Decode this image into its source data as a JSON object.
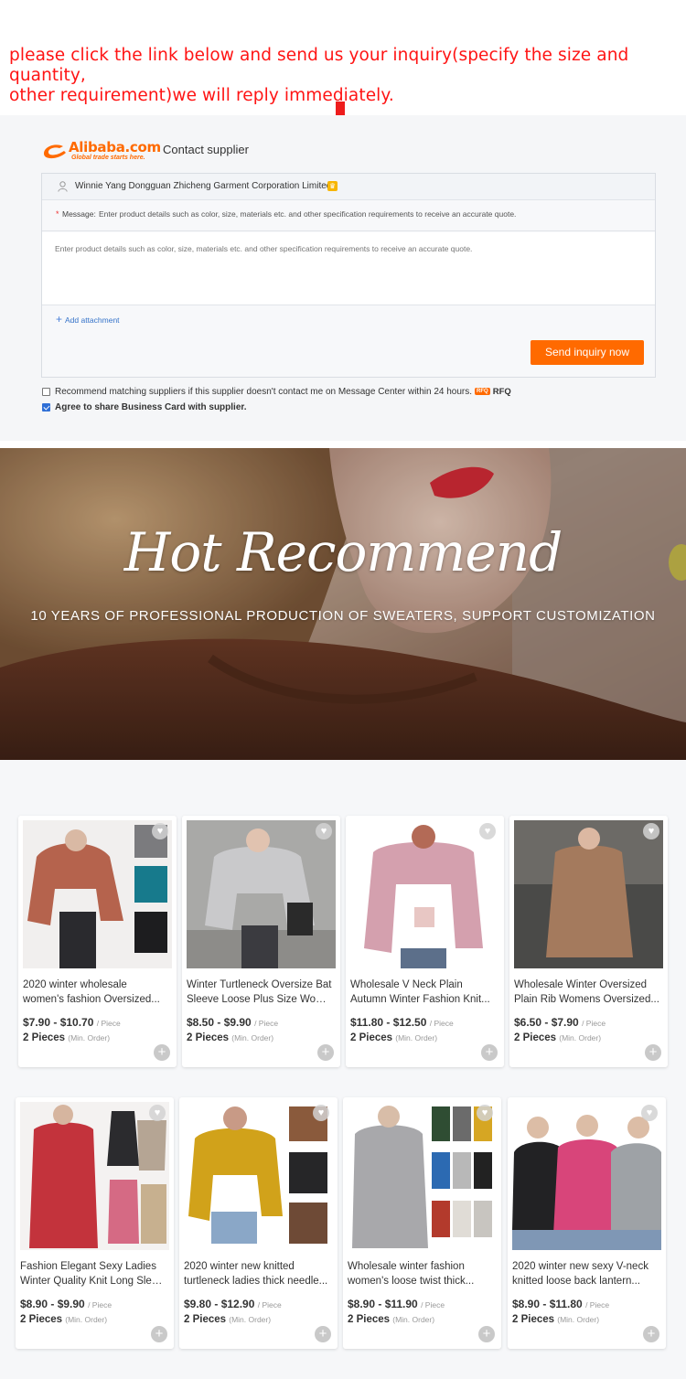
{
  "instruction": {
    "line1": "please click the link below and send us your inquiry(specify the size and quantity,",
    "line2": "other requirement)we will reply immediately."
  },
  "inquiry_form": {
    "logo_text": "Alibaba.com",
    "logo_tagline": "Global trade starts here.",
    "title": "Contact supplier",
    "supplier_name": "Winnie Yang Dongguan Zhicheng Garment Corporation Limited",
    "message_label": "Message:",
    "message_hint": "Enter product details such as color, size, materials etc. and other specification requirements to receive an accurate quote.",
    "message_placeholder": "Enter product details such as color, size, materials etc. and other specification requirements to receive an accurate quote.",
    "add_attachment": "Add attachment",
    "send_button": "Send inquiry now",
    "recommend_checkbox": {
      "label": "Recommend matching suppliers if this supplier doesn't contact me on Message Center within 24 hours.",
      "badge": "RFQ",
      "rfq_label": "RFQ",
      "checked": false
    },
    "business_card_checkbox": {
      "label": "Agree to share Business Card with supplier.",
      "checked": true
    },
    "colors": {
      "accent": "#ff6a00",
      "instruction_red": "#ff1414",
      "link_blue": "#3573c9"
    }
  },
  "banner": {
    "title": "Hot Recommend",
    "subtitle": "10 YEARS OF PROFESSIONAL PRODUCTION OF SWEATERS, SUPPORT CUSTOMIZATION"
  },
  "products": [
    {
      "title_line1": "2020 winter wholesale",
      "title_line2": "women's fashion Oversized...",
      "price": "$7.90 - $10.70",
      "unit": "/ Piece",
      "moq": "2 Pieces",
      "moq_note": "(Min. Order)"
    },
    {
      "title_line1": "Winter Turtleneck Oversize Bat",
      "title_line2": "Sleeve Loose Plus Size Wome...",
      "price": "$8.50 - $9.90",
      "unit": "/ Piece",
      "moq": "2 Pieces",
      "moq_note": "(Min. Order)"
    },
    {
      "title_line1": "Wholesale V Neck Plain",
      "title_line2": "Autumn Winter Fashion Knit...",
      "price": "$11.80 - $12.50",
      "unit": "/ Piece",
      "moq": "2 Pieces",
      "moq_note": "(Min. Order)"
    },
    {
      "title_line1": "Wholesale Winter Oversized",
      "title_line2": "Plain Rib Womens Oversized...",
      "price": "$6.50 - $7.90",
      "unit": "/ Piece",
      "moq": "2 Pieces",
      "moq_note": "(Min. Order)"
    },
    {
      "title_line1": "Fashion Elegant Sexy Ladies",
      "title_line2": "Winter Quality Knit Long Sleev...",
      "price": "$8.90 - $9.90",
      "unit": "/ Piece",
      "moq": "2 Pieces",
      "moq_note": "(Min. Order)"
    },
    {
      "title_line1": "2020 winter new knitted",
      "title_line2": "turtleneck ladies thick needle...",
      "price": "$9.80 - $12.90",
      "unit": "/ Piece",
      "moq": "2 Pieces",
      "moq_note": "(Min. Order)"
    },
    {
      "title_line1": "Wholesale winter fashion",
      "title_line2": "women's loose twist thick...",
      "price": "$8.90 - $11.90",
      "unit": "/ Piece",
      "moq": "2 Pieces",
      "moq_note": "(Min. Order)"
    },
    {
      "title_line1": "2020 winter new sexy V-neck",
      "title_line2": "knitted loose back lantern...",
      "price": "$8.90 - $11.80",
      "unit": "/ Piece",
      "moq": "2 Pieces",
      "moq_note": "(Min. Order)"
    }
  ]
}
